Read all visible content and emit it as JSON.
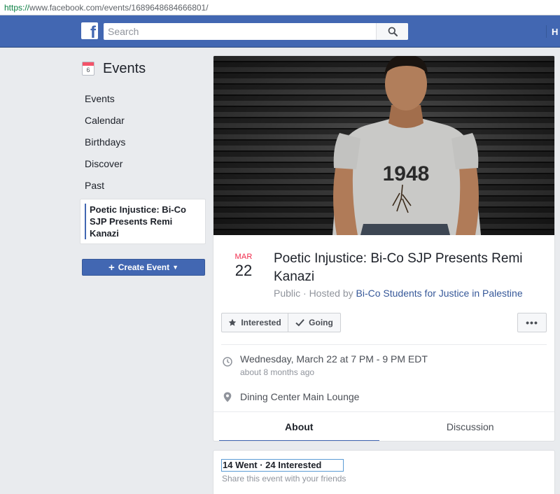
{
  "browser": {
    "url_scheme": "https://",
    "url_rest": "www.facebook.com/events/1689648684666801/"
  },
  "header": {
    "search_placeholder": "Search",
    "right_label": "H",
    "brand_color": "#4267b2"
  },
  "sidebar": {
    "calendar_icon_day": "6",
    "title": "Events",
    "items": [
      {
        "label": "Events"
      },
      {
        "label": "Calendar"
      },
      {
        "label": "Birthdays"
      },
      {
        "label": "Discover"
      },
      {
        "label": "Past"
      }
    ],
    "active_item": "Poetic Injustice: Bi-Co SJP Presents Remi Kanazi",
    "create_button": "Create Event"
  },
  "event": {
    "cover_shirt_text": "1948",
    "month": "MAR",
    "day": "22",
    "title": "Poetic Injustice: Bi-Co SJP Presents Remi Kanazi",
    "privacy_prefix": "Public · Hosted by ",
    "host": "Bi-Co Students for Justice in Palestine",
    "buttons": {
      "interested": "Interested",
      "going": "Going",
      "more": "•••"
    },
    "time": "Wednesday, March 22 at 7 PM - 9 PM EDT",
    "time_relative": "about 8 months ago",
    "location": "Dining Center Main Lounge",
    "tabs": [
      "About",
      "Discussion"
    ]
  },
  "stats": {
    "counts": "14 Went · 24 Interested",
    "share_text": "Share this event with your friends"
  }
}
